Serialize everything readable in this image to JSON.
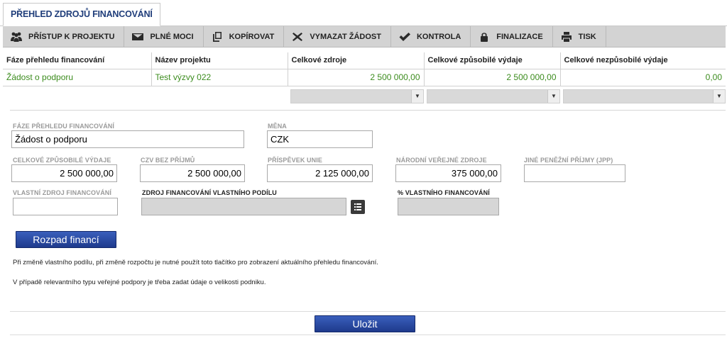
{
  "tab": {
    "label": "PŘEHLED ZDROJŮ FINANCOVÁNÍ"
  },
  "toolbar": {
    "buttons": [
      {
        "label": "PŘÍSTUP K PROJEKTU",
        "icon": "people-icon"
      },
      {
        "label": "PLNÉ MOCI",
        "icon": "envelope-icon"
      },
      {
        "label": "KOPÍROVAT",
        "icon": "copy-icon"
      },
      {
        "label": "VYMAZAT ŽÁDOST",
        "icon": "x-icon"
      },
      {
        "label": "KONTROLA",
        "icon": "checkmark-icon"
      },
      {
        "label": "FINALIZACE",
        "icon": "lock-icon"
      },
      {
        "label": "TISK",
        "icon": "printer-icon"
      }
    ]
  },
  "grid": {
    "columns": [
      "Fáze přehledu financování",
      "Název projektu",
      "Celkové zdroje",
      "Celkové způsobilé výdaje",
      "Celkové nezpůsobilé výdaje"
    ],
    "rows": [
      [
        "Žádost o podporu",
        "Test výzvy 022",
        "2 500 000,00",
        "2 500 000,00",
        "0,00"
      ]
    ]
  },
  "form": {
    "faze": {
      "label": "FÁZE PŘEHLEDU FINANCOVÁNÍ",
      "value": "Žádost o podporu"
    },
    "mena": {
      "label": "MĚNA",
      "value": "CZK"
    },
    "czv": {
      "label": "CELKOVÉ ZPŮSOBILÉ VÝDAJE",
      "value": "2 500 000,00"
    },
    "czv_bez": {
      "label": "CZV BEZ PŘÍJMŮ",
      "value": "2 500 000,00"
    },
    "prispevek": {
      "label": "PŘÍSPĚVEK UNIE",
      "value": "2 125 000,00"
    },
    "narodni": {
      "label": "NÁRODNÍ VEŘEJNÉ ZDROJE",
      "value": "375 000,00"
    },
    "jine": {
      "label": "JINÉ PENĚŽNÍ PŘÍJMY (JPP)",
      "value": ""
    },
    "vlastni": {
      "label": "VLASTNÍ ZDROJ FINANCOVÁNÍ",
      "value": ""
    },
    "zdroj_vp": {
      "label": "ZDROJ FINANCOVÁNÍ VLASTNÍHO PODÍLU",
      "value": ""
    },
    "pct_vlastni": {
      "label": "% VLASTNÍHO FINANCOVÁNÍ",
      "value": ""
    },
    "rozpad_button": "Rozpad financí",
    "note1": "Při změně vlastního podílu, při změně rozpočtu je nutné použít toto tlačítko pro zobrazení aktuálního přehledu financování.",
    "note2": "V případě relevantního typu veřejné podpory je třeba zadat údaje o velikosti podniku.",
    "save_button": "Uložit"
  }
}
